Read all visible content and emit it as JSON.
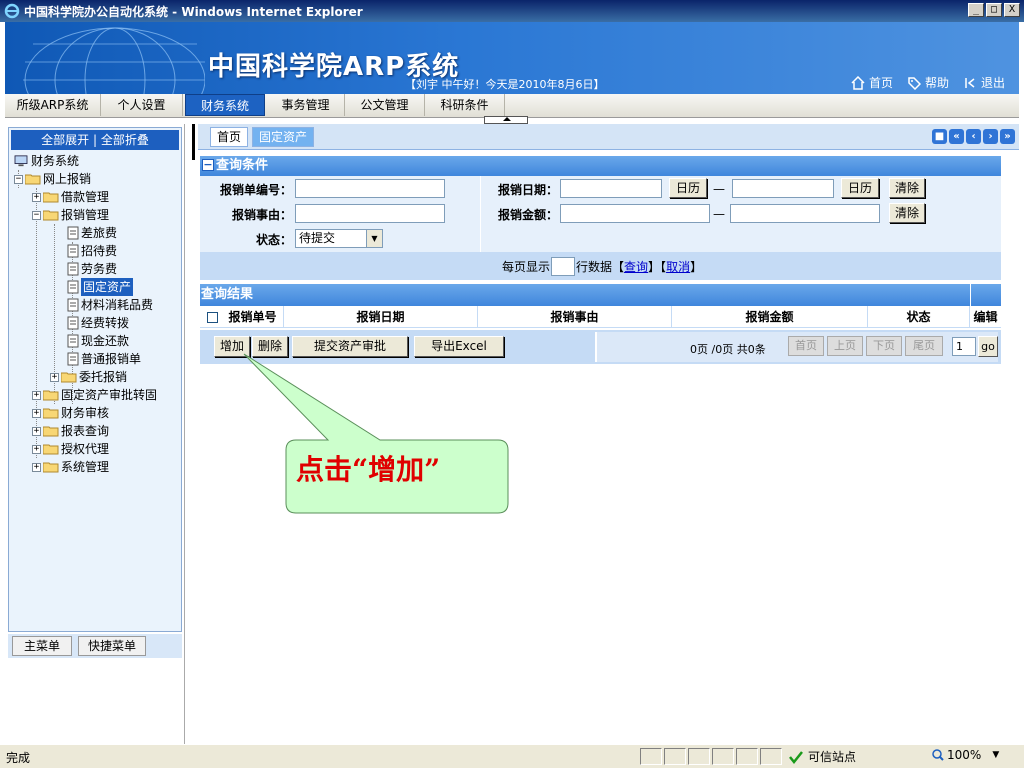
{
  "window": {
    "title": "中国科学院办公自动化系统 - Windows Internet Explorer",
    "controls": [
      "_",
      "□",
      "X"
    ]
  },
  "banner": {
    "title": "中国科学院ARP系统",
    "greeting": "【刘宇 中午好！今天是2010年8月6日】",
    "links": {
      "home": "首页",
      "help": "帮助",
      "logout": "退出"
    }
  },
  "menu": [
    "所级ARP系统",
    "个人设置",
    "财务系统",
    "事务管理",
    "公文管理",
    "科研条件"
  ],
  "left": {
    "expand_all": "全部展开",
    "sep": "|",
    "collapse_all": "全部折叠",
    "tree": {
      "root": "财务系统",
      "online": "网上报销",
      "loan": "借款管理",
      "reimb": "报销管理",
      "leaves": [
        "差旅费",
        "招待费",
        "劳务费",
        "固定资产",
        "材料消耗品费",
        "经费转拨",
        "现金还款",
        "普通报销单"
      ],
      "entrust": "委托报销",
      "others": [
        "固定资产审批转固",
        "财务审核",
        "报表查询",
        "授权代理",
        "系统管理"
      ]
    },
    "tabs": {
      "main": "主菜单",
      "quick": "快捷菜单"
    }
  },
  "main": {
    "tabs": {
      "home": "首页",
      "current": "固定资产"
    },
    "nav_glyphs": [
      "■",
      "«",
      "‹",
      "›",
      "»"
    ],
    "query": {
      "title": "查询条件",
      "no_label": "报销单编号：",
      "date_label": "报销日期：",
      "reason_label": "报销事由：",
      "amount_label": "报销金额：",
      "status_label": "状态：",
      "status_value": "待提交",
      "calendar": "日历",
      "clear": "清除",
      "dash": "—"
    },
    "pager_top": {
      "prefix": "每页显示",
      "suffix": "行数据【",
      "query": "查询",
      "mid": "】【",
      "cancel": "取消",
      "end": "】"
    },
    "results": {
      "title": "查询结果",
      "columns": [
        "报销单号",
        "报销日期",
        "报销事由",
        "报销金额",
        "状态",
        "编辑"
      ],
      "buttons": {
        "add": "增加",
        "delete": "删除",
        "submit": "提交资产审批",
        "export": "导出Excel"
      },
      "page_info": "0页 /0页  共0条",
      "first": "首页",
      "prev": "上页",
      "next": "下页",
      "last": "尾页",
      "page_input": "1",
      "go": "go"
    }
  },
  "callout": "点击“增加”",
  "status": {
    "left": "完成",
    "zone": "可信站点",
    "zoom": "100%"
  },
  "colors": {
    "accent": "#1d5fbf",
    "callout_fill": "#ccffcc",
    "callout_text": "#e00000"
  }
}
